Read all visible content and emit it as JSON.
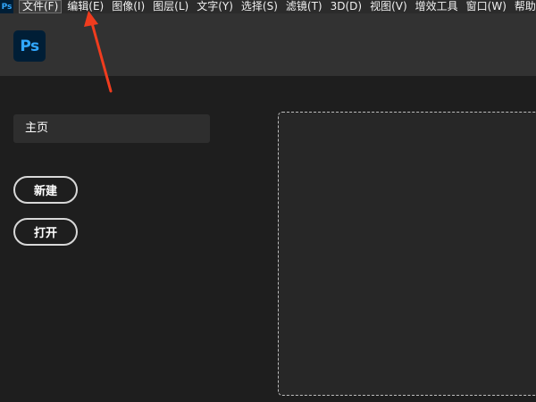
{
  "app": {
    "logo_text": "Ps",
    "accent_color": "#31a8ff",
    "logo_bg": "#001e36"
  },
  "menubar": {
    "items": [
      {
        "label": "文件(F)"
      },
      {
        "label": "编辑(E)"
      },
      {
        "label": "图像(I)"
      },
      {
        "label": "图层(L)"
      },
      {
        "label": "文字(Y)"
      },
      {
        "label": "选择(S)"
      },
      {
        "label": "滤镜(T)"
      },
      {
        "label": "3D(D)"
      },
      {
        "label": "视图(V)"
      },
      {
        "label": "增效工具"
      },
      {
        "label": "窗口(W)"
      },
      {
        "label": "帮助"
      }
    ],
    "active_item": "文件(F)"
  },
  "home": {
    "tab_label": "主页",
    "new_button": "新建",
    "open_button": "打开"
  },
  "annotation": {
    "arrow_color": "#f03c1e",
    "points_to": "编辑(E)"
  }
}
